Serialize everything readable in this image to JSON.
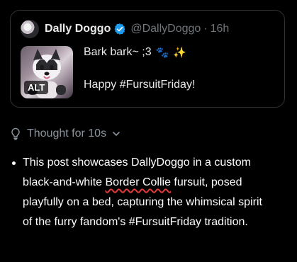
{
  "post": {
    "display_name": "Dally Doggo",
    "handle": "@DallyDoggo",
    "separator": "·",
    "time": "16h",
    "alt_badge": "ALT",
    "line1_text": "Bark bark~ ;3",
    "line1_emoji_paws": "🐾",
    "line1_emoji_sparkles": "✨",
    "line2_text": "Happy #FursuitFriday!"
  },
  "thought": {
    "label": "Thought for 10s"
  },
  "answer": {
    "part1": "This post showcases DallyDoggo in a custom black-and-white ",
    "highlight": "Border Collie",
    "part2": " fursuit, posed playfully on a bed, capturing the whimsical spirit of the furry fandom's #FursuitFriday tradition."
  },
  "colors": {
    "background": "#000000",
    "text": "#e7e9ea",
    "muted": "#71767b",
    "verified": "#1d9bf0",
    "underline": "#e33a3a"
  },
  "icons": {
    "verified": "verified-badge-icon",
    "thought": "lightbulb-icon",
    "expand": "chevron-down-icon"
  }
}
